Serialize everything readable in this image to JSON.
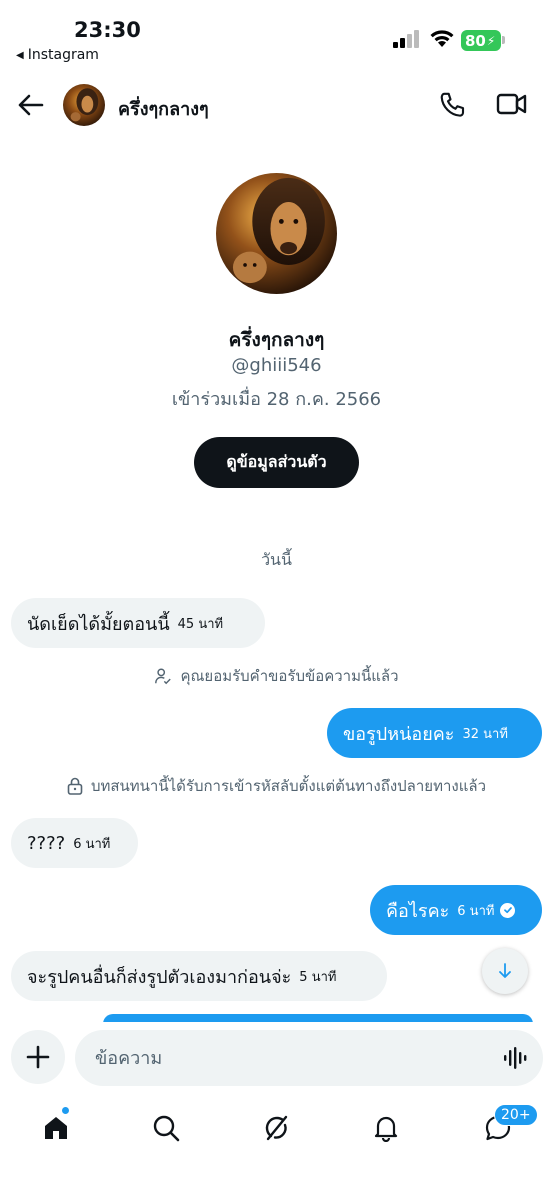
{
  "status_bar": {
    "time": "23:30",
    "back_app": "Instagram",
    "battery": "80"
  },
  "header": {
    "name": "ครึ่งๆกลางๆ"
  },
  "profile": {
    "name": "ครึ่งๆกลางๆ",
    "handle": "@ghiii546",
    "joined": "เข้าร่วมเมื่อ 28 ก.ค. 2566",
    "view_button": "ดูข้อมูลส่วนตัว"
  },
  "conversation": {
    "date_separator": "วันนี้",
    "messages": [
      {
        "direction": "in",
        "text": "นัดเย็ดได้มั้ยตอนนี้",
        "time": "45 นาที"
      },
      {
        "direction": "out",
        "text": "ขอรูปหน่อยคะ",
        "time": "32 นาที"
      },
      {
        "direction": "in",
        "text": "????",
        "time": "6 นาที"
      },
      {
        "direction": "out",
        "text": "คือไรคะ",
        "time": "6 นาที",
        "read": true
      },
      {
        "direction": "in",
        "text": "จะรูปคนอื่นก็ส่งรูปตัวเองมาก่อนจ่ะ",
        "time": "5 นาที"
      }
    ],
    "notes": {
      "accepted": "คุณยอมรับคำขอรับข้อความนี้แล้ว",
      "encrypted": "บทสนทนานี้ได้รับการเข้ารหัสลับตั้งแต่ต้นทางถึงปลายทางแล้ว"
    }
  },
  "composer": {
    "placeholder": "ข้อความ"
  },
  "bottom_nav": {
    "messages_badge": "20+"
  },
  "colors": {
    "accent": "#1d9bf0",
    "incoming_bubble": "#eff3f4",
    "button_dark": "#0f1419",
    "secondary_text": "#536471",
    "battery": "#34c759"
  }
}
